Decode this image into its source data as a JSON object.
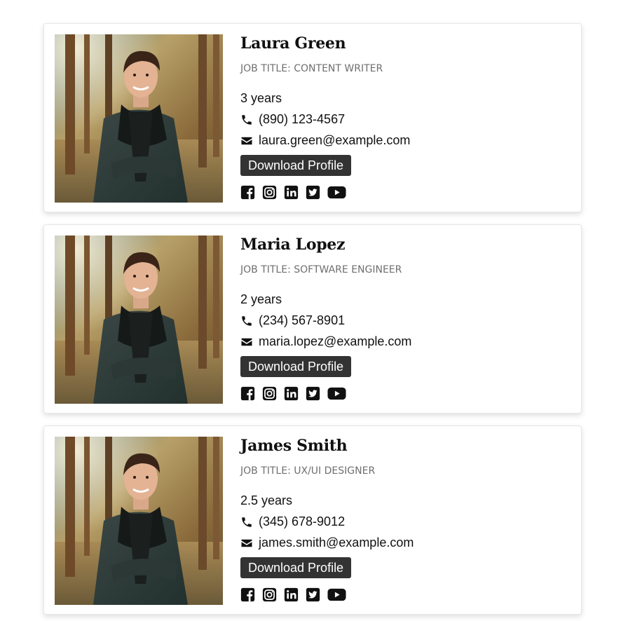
{
  "colors": {
    "button_bg": "#333333",
    "button_text": "#ffffff",
    "job_title_text": "#6f6f6f",
    "icon": "#111111"
  },
  "icons": {
    "photo": "portrait-photo",
    "phone": "phone-icon",
    "email": "envelope-icon",
    "social": [
      "facebook-icon",
      "instagram-icon",
      "linkedin-icon",
      "twitter-icon",
      "youtube-icon"
    ]
  },
  "profiles": [
    {
      "name": "Laura Green",
      "job_title": "JOB TITLE: CONTENT WRITER",
      "experience": "3 years",
      "phone": "(890) 123-4567",
      "email": "laura.green@example.com",
      "download_label": "Download Profile"
    },
    {
      "name": "Maria Lopez",
      "job_title": "JOB TITLE: SOFTWARE ENGINEER",
      "experience": "2 years",
      "phone": "(234) 567-8901",
      "email": "maria.lopez@example.com",
      "download_label": "Download Profile"
    },
    {
      "name": "James Smith",
      "job_title": "JOB TITLE: UX/UI DESIGNER",
      "experience": "2.5 years",
      "phone": "(345) 678-9012",
      "email": "james.smith@example.com",
      "download_label": "Download Profile"
    }
  ]
}
